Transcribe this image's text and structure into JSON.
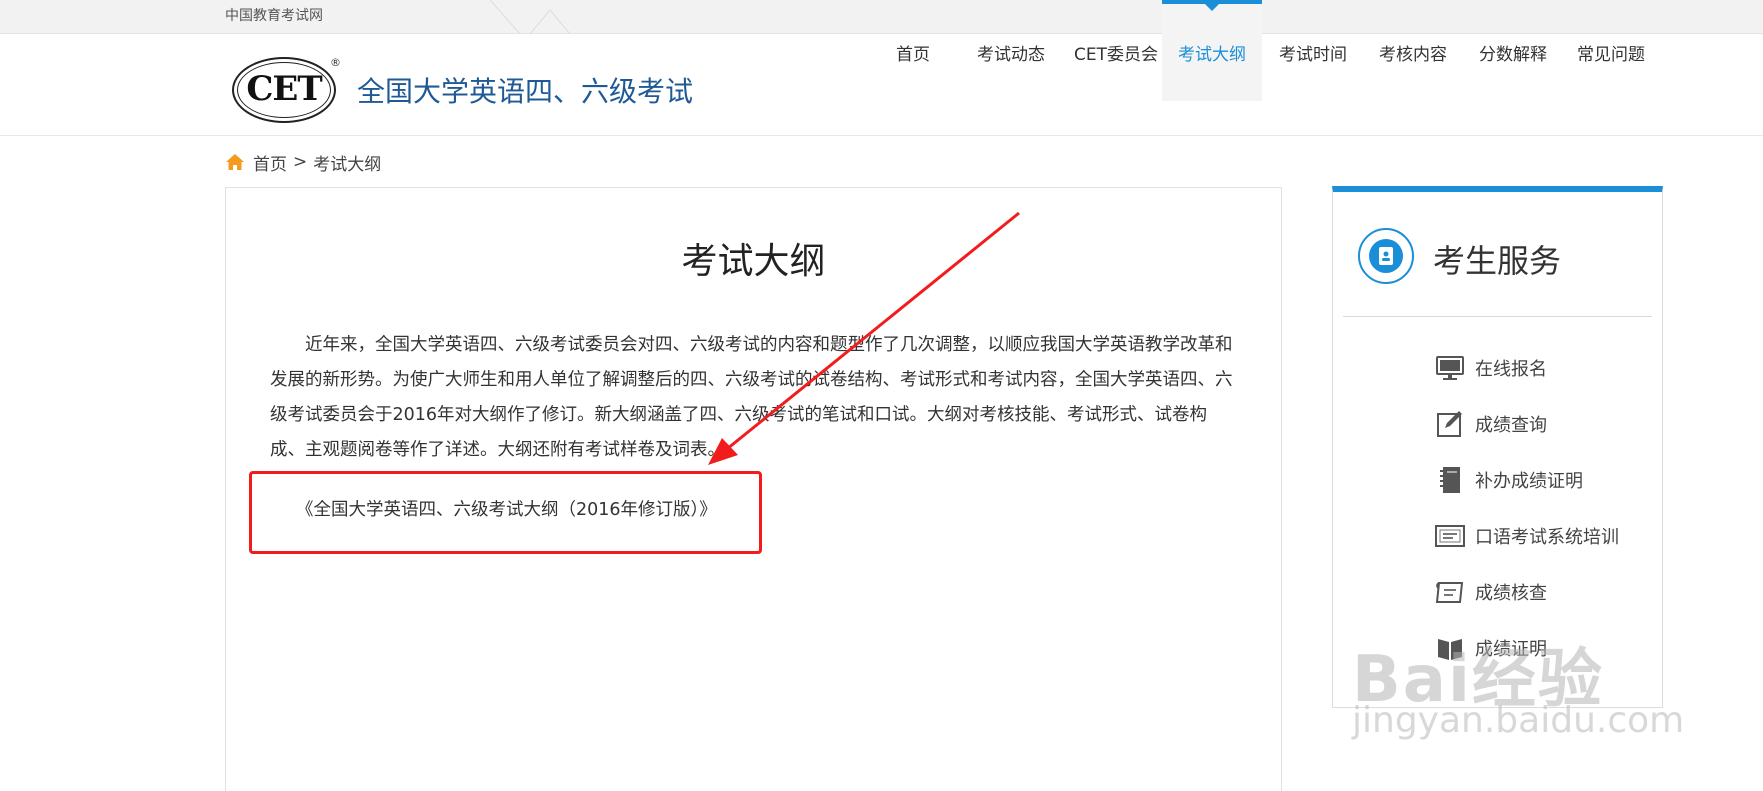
{
  "topbar": {
    "site_name": "中国教育考试网"
  },
  "header": {
    "logo_text": "CET",
    "logo_mark": "®",
    "site_title": "全国大学英语四、六级考试"
  },
  "nav": {
    "items": [
      {
        "label": "首页"
      },
      {
        "label": "考试动态"
      },
      {
        "label": "CET委员会"
      },
      {
        "label": "考试大纲",
        "active": true
      },
      {
        "label": "考试时间"
      },
      {
        "label": "考核内容"
      },
      {
        "label": "分数解释"
      },
      {
        "label": "常见问题"
      }
    ]
  },
  "breadcrumb": {
    "home": "首页",
    "separator": ">",
    "current": "考试大纲"
  },
  "article": {
    "title": "考试大纲",
    "body": "近年来，全国大学英语四、六级考试委员会对四、六级考试的内容和题型作了几次调整，以顺应我国大学英语教学改革和发展的新形势。为使广大师生和用人单位了解调整后的四、六级考试的试卷结构、考试形式和考试内容，全国大学英语四、六级考试委员会于2016年对大纲作了修订。新大纲涵盖了四、六级考试的笔试和口试。大纲对考核技能、考试形式、试卷构成、主观题阅卷等作了详述。大纲还附有考试样卷及词表。",
    "doc_link": "《全国大学英语四、六级考试大纲（2016年修订版）》"
  },
  "sidebar": {
    "title": "考生服务",
    "items": [
      {
        "label": "在线报名",
        "icon": "monitor-icon"
      },
      {
        "label": "成绩查询",
        "icon": "edit-icon"
      },
      {
        "label": "补办成绩证明",
        "icon": "notebook-icon"
      },
      {
        "label": "口语考试系统培训",
        "icon": "keyboard-icon"
      },
      {
        "label": "成绩核查",
        "icon": "certificate-icon"
      },
      {
        "label": "成绩证明",
        "icon": "book-icon"
      }
    ]
  },
  "watermark": {
    "brand": "Bai经验",
    "url": "jingyan.baidu.com"
  },
  "colors": {
    "accent": "#1a8fd8",
    "title_blue": "#1f5a96",
    "annotation_red": "#f21c1c",
    "home_orange": "#f39a1f"
  }
}
